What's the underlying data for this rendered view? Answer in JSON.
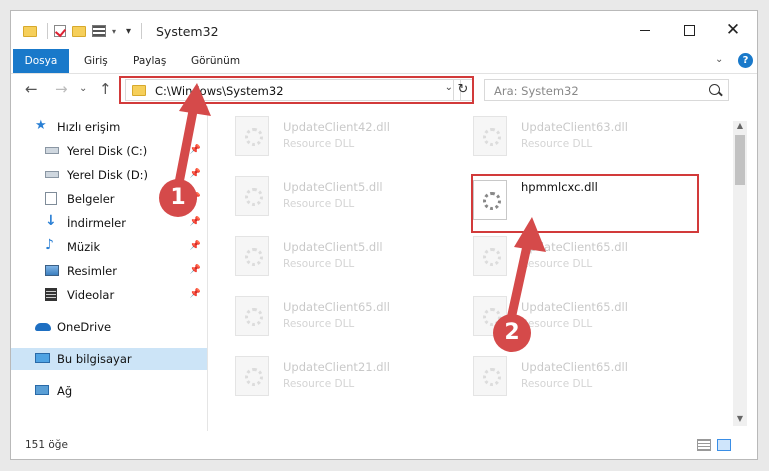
{
  "window": {
    "title": "System32"
  },
  "ribbon": {
    "tabs": [
      "Dosya",
      "Giriş",
      "Paylaş",
      "Görünüm"
    ],
    "help": "?"
  },
  "navigation": {
    "address": "C:\\Windows\\System32",
    "search_placeholder": "Ara: System32"
  },
  "sidebar": {
    "items": [
      {
        "label": "Hızlı erişim",
        "icon": "star-icon"
      },
      {
        "label": "Yerel Disk (C:)",
        "icon": "drive-icon",
        "pinned": true
      },
      {
        "label": "Yerel Disk (D:)",
        "icon": "drive-icon",
        "pinned": true
      },
      {
        "label": "Belgeler",
        "icon": "documents-icon",
        "pinned": true
      },
      {
        "label": "İndirmeler",
        "icon": "download-icon",
        "pinned": true
      },
      {
        "label": "Müzik",
        "icon": "music-icon",
        "pinned": true
      },
      {
        "label": "Resimler",
        "icon": "pictures-icon",
        "pinned": true
      },
      {
        "label": "Videolar",
        "icon": "videos-icon",
        "pinned": true
      },
      {
        "label": "OneDrive",
        "icon": "cloud-icon"
      },
      {
        "label": "Bu bilgisayar",
        "icon": "computer-icon",
        "selected": true
      },
      {
        "label": "Ağ",
        "icon": "network-icon"
      }
    ]
  },
  "files": [
    {
      "name": "UpdateClient42.dll",
      "type": "Resource DLL"
    },
    {
      "name": "UpdateClient63.dll",
      "type": "Resource DLL"
    },
    {
      "name": "UpdateClient5.dll",
      "type": "Resource DLL"
    },
    {
      "name": "hpmmlcxc.dll",
      "type": "",
      "focus": true
    },
    {
      "name": "UpdateClient5.dll",
      "type": "Resource DLL"
    },
    {
      "name": "UpdateClient65.dll",
      "type": "Resource DLL"
    },
    {
      "name": "UpdateClient65.dll",
      "type": "Resource DLL"
    },
    {
      "name": "UpdateClient65.dll",
      "type": "Resource DLL"
    },
    {
      "name": "UpdateClient21.dll",
      "type": "Resource DLL"
    },
    {
      "name": "UpdateClient65.dll",
      "type": "Resource DLL"
    }
  ],
  "status": {
    "count": "151 öğe"
  },
  "annotations": {
    "step1": "1",
    "step2": "2"
  },
  "colors": {
    "accent": "#1979ca",
    "highlight": "#d23a3a",
    "badge": "#d54a4a"
  }
}
